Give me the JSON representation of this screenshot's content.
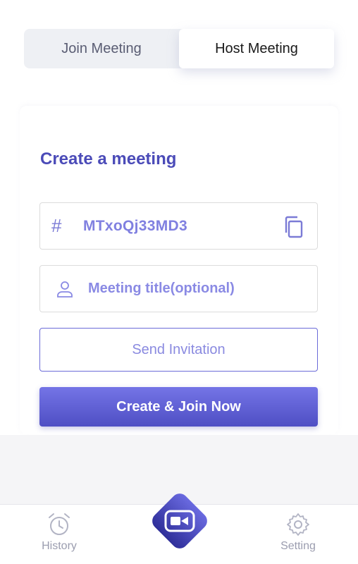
{
  "tabs": {
    "join": "Join Meeting",
    "host": "Host Meeting",
    "active": "host"
  },
  "form": {
    "heading": "Create a meeting",
    "meeting_code_prefix": "#",
    "meeting_code": "MTxoQj33MD3",
    "title_placeholder": "Meeting title(optional)",
    "send_invitation": "Send Invitation",
    "create_join": "Create & Join Now"
  },
  "nav": {
    "history": "History",
    "setting": "Setting",
    "center_icon": "video-camera-icon"
  },
  "colors": {
    "accent": "#5a5ad0",
    "heading": "#4b4bb8",
    "nav_gray": "#9b9daf"
  }
}
